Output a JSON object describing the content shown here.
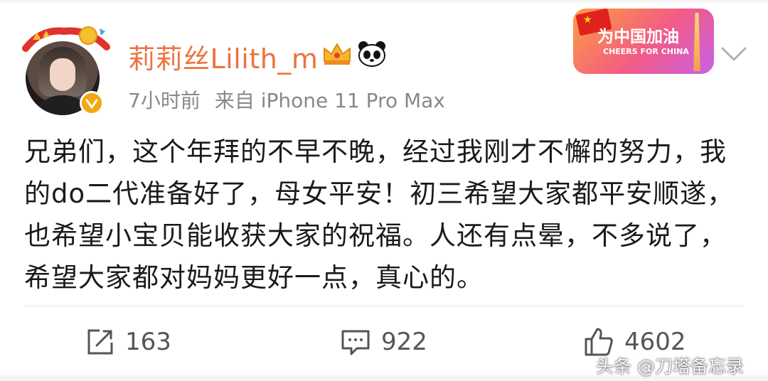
{
  "post": {
    "username": "莉莉丝Lilith_m",
    "time": "7小时前",
    "source": "来自 iPhone 11 Pro Max",
    "content": "兄弟们，这个年拜的不早不晚，经过我刚才不懈的努力，我的do二代准备好了，母女平安！初三希望大家都平安顺遂，也希望小宝贝能收获大家的祝福。人还有点晕，不多说了，希望大家都对妈妈更好一点，真心的。"
  },
  "badge": {
    "title": "为中国加油",
    "subtitle": "CHEERS FOR CHINA"
  },
  "actions": {
    "repost_count": "163",
    "comment_count": "922",
    "like_count": "4602"
  },
  "watermark": "头条 @刀塔备忘录",
  "icons": {
    "verified": "verified-badge-icon",
    "crown": "crown-icon",
    "panda": "panda-icon",
    "menu": "chevron-down-icon",
    "repost": "repost-icon",
    "comment": "comment-icon",
    "like": "thumbs-up-icon"
  },
  "colors": {
    "username": "#eb7340",
    "meta": "#888888",
    "verified": "#f4a712",
    "text": "#1a1a1a"
  }
}
